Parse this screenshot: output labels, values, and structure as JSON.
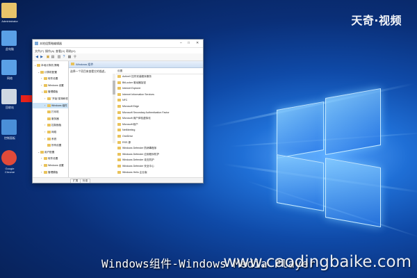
{
  "logo": {
    "text": "天奇·视频"
  },
  "desktop": {
    "icons": [
      {
        "label": "Administrator",
        "color": "#e8c46a",
        "symbol": "user-folder"
      },
      {
        "label": "此电脑",
        "color": "#5aa0e6",
        "symbol": "computer"
      },
      {
        "label": "网络",
        "color": "#5aa0e6",
        "symbol": "network"
      },
      {
        "label": "回收站",
        "color": "#cfd8e3",
        "symbol": "recycle-bin"
      },
      {
        "label": "控制面板",
        "color": "#4a8fd8",
        "symbol": "control-panel"
      },
      {
        "label": "Google Chrome",
        "color": "#e04a3a",
        "symbol": "chrome"
      }
    ]
  },
  "window": {
    "title": "本地组策略编辑器",
    "menu": [
      "文件(F)",
      "操作(A)",
      "查看(V)",
      "帮助(H)"
    ],
    "tree": [
      {
        "label": "本地计算机 策略",
        "indent": 0,
        "expander": "v",
        "selected": false
      },
      {
        "label": "计算机配置",
        "indent": 1,
        "expander": "v",
        "selected": false
      },
      {
        "label": "软件设置",
        "indent": 2,
        "expander": ">",
        "selected": false
      },
      {
        "label": "Windows 设置",
        "indent": 2,
        "expander": ">",
        "selected": false
      },
      {
        "label": "管理模板",
        "indent": 2,
        "expander": "v",
        "selected": false
      },
      {
        "label": "\"开始\"菜单和任务栏",
        "indent": 3,
        "expander": ">",
        "selected": false
      },
      {
        "label": "Windows 组件",
        "indent": 3,
        "expander": ">",
        "selected": true
      },
      {
        "label": "打印机",
        "indent": 3,
        "expander": "",
        "selected": false
      },
      {
        "label": "服务器",
        "indent": 3,
        "expander": "",
        "selected": false
      },
      {
        "label": "控制面板",
        "indent": 3,
        "expander": ">",
        "selected": false
      },
      {
        "label": "网络",
        "indent": 3,
        "expander": ">",
        "selected": false
      },
      {
        "label": "系统",
        "indent": 3,
        "expander": ">",
        "selected": false
      },
      {
        "label": "所有设置",
        "indent": 3,
        "expander": "",
        "selected": false
      },
      {
        "label": "用户配置",
        "indent": 1,
        "expander": "v",
        "selected": false
      },
      {
        "label": "软件设置",
        "indent": 2,
        "expander": ">",
        "selected": false
      },
      {
        "label": "Windows 设置",
        "indent": 2,
        "expander": ">",
        "selected": false
      },
      {
        "label": "管理模板",
        "indent": 2,
        "expander": ">",
        "selected": false
      }
    ],
    "details_header": "Windows 组件",
    "details_description": "选择一个项目来查看它的描述。",
    "column_header": "设置",
    "list_items": [
      "ActiveX 控件安装程序服务",
      "BitLocker 驱动器加密",
      "Internet Explorer",
      "Internet Information Services",
      "NFC",
      "Microsoft Edge",
      "Microsoft Secondary Authentication Factor",
      "Microsoft 用户体验虚拟化",
      "Microsoft 帐户",
      "NetMeeting",
      "OneDrive",
      "RSS 源",
      "Windows Defender 防病毒程序",
      "Windows Defender 应用程序防护",
      "Windows Defender 攻击防护",
      "Windows Defender 安全中心",
      "Windows Hello 企业版"
    ],
    "status_tabs": [
      "扩展",
      "标准"
    ]
  },
  "caption": "Windows组件-Windows Media Player",
  "watermark": "www.caodingbaike.com"
}
